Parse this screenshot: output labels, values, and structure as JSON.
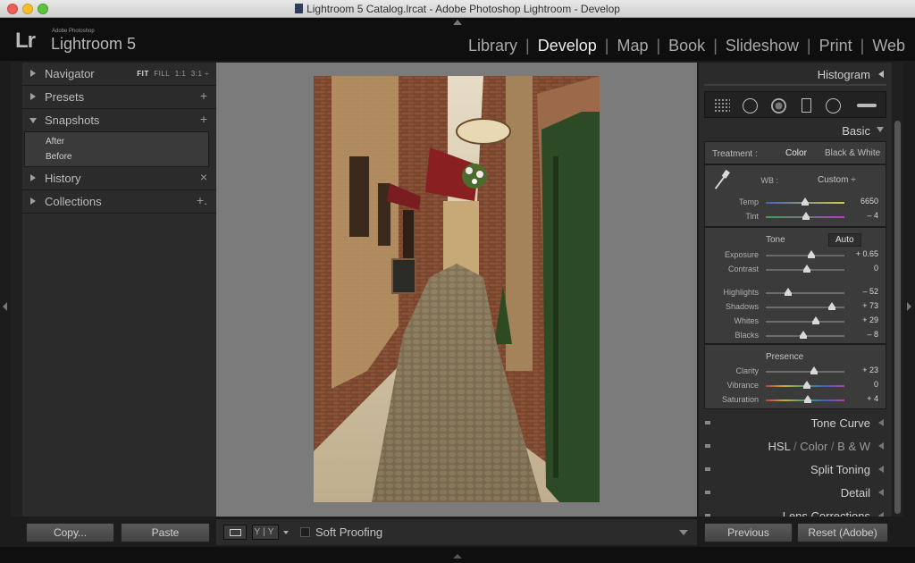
{
  "window": {
    "title": "Lightroom 5 Catalog.lrcat - Adobe Photoshop Lightroom - Develop"
  },
  "identity": {
    "logo": "Lr",
    "adobe": "Adobe Photoshop",
    "product": "Lightroom 5"
  },
  "modules": [
    "Library",
    "Develop",
    "Map",
    "Book",
    "Slideshow",
    "Print",
    "Web"
  ],
  "active_module": "Develop",
  "left_panel": {
    "navigator": {
      "label": "Navigator",
      "opt_fit": "FIT",
      "opt_fill": "FILL",
      "opt_1": "1:1",
      "opt_3": "3:1 ÷"
    },
    "presets": {
      "label": "Presets",
      "action": "+"
    },
    "snapshots": {
      "label": "Snapshots",
      "action": "+",
      "items": [
        "After",
        "Before"
      ]
    },
    "history": {
      "label": "History",
      "action": "×"
    },
    "collections": {
      "label": "Collections",
      "action": "+."
    },
    "copy_label": "Copy...",
    "paste_label": "Paste"
  },
  "toolbar": {
    "yy_label": "Y|Y",
    "soft_proofing": "Soft Proofing"
  },
  "right_panel": {
    "histogram": "Histogram",
    "basic": "Basic",
    "treatment_label": "Treatment :",
    "treatment_color": "Color",
    "treatment_bw": "Black & White",
    "wb_label": "WB :",
    "wb_value": "Custom ÷",
    "temp": {
      "label": "Temp",
      "value": "6650",
      "pos": 0.48
    },
    "tint": {
      "label": "Tint",
      "value": "– 4",
      "pos": 0.49
    },
    "tone_title": "Tone",
    "auto": "Auto",
    "exposure": {
      "label": "Exposure",
      "value": "+ 0.65",
      "pos": 0.56
    },
    "contrast": {
      "label": "Contrast",
      "value": "0",
      "pos": 0.5
    },
    "highlights": {
      "label": "Highlights",
      "value": "– 52",
      "pos": 0.26
    },
    "shadows": {
      "label": "Shadows",
      "value": "+ 73",
      "pos": 0.86
    },
    "whites": {
      "label": "Whites",
      "value": "+ 29",
      "pos": 0.64
    },
    "blacks": {
      "label": "Blacks",
      "value": "– 8",
      "pos": 0.46
    },
    "presence_title": "Presence",
    "clarity": {
      "label": "Clarity",
      "value": "+ 23",
      "pos": 0.61
    },
    "vibrance": {
      "label": "Vibrance",
      "value": "0",
      "pos": 0.5
    },
    "saturation": {
      "label": "Saturation",
      "value": "+ 4",
      "pos": 0.52
    },
    "tone_curve": "Tone Curve",
    "hsl": "HSL",
    "hsl_sep1": "/",
    "hsl_color": "Color",
    "hsl_sep2": "/",
    "hsl_bw": "B & W",
    "split_toning": "Split Toning",
    "detail": "Detail",
    "lens": "Lens Corrections",
    "previous": "Previous",
    "reset": "Reset (Adobe)"
  }
}
